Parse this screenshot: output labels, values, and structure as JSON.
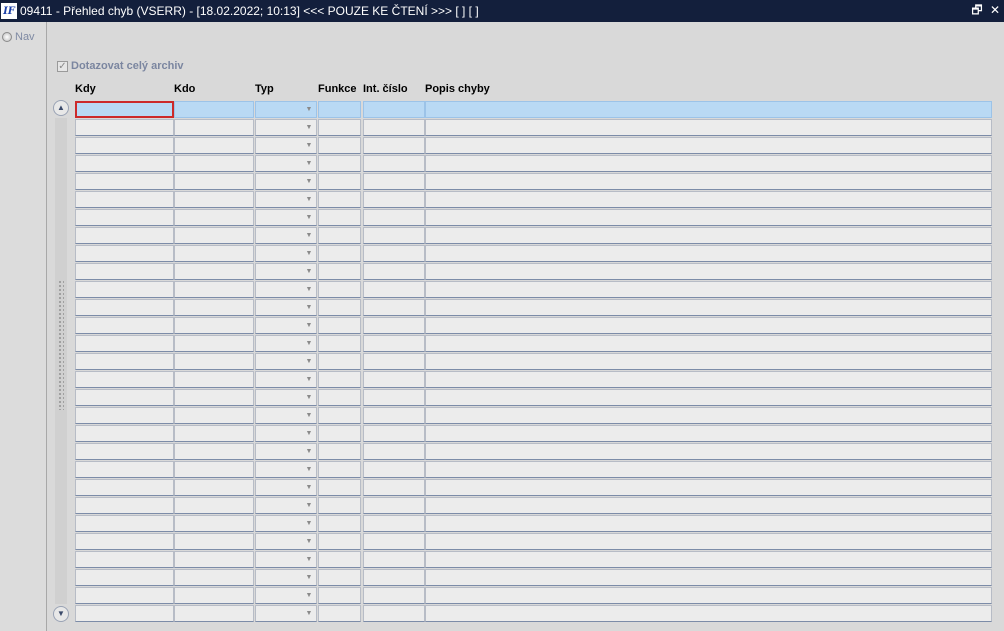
{
  "window": {
    "title": "09411 - Přehled chyb (VSERR) - [18.02.2022; 10:13] <<< POUZE KE ČTENÍ >>>  [ ]  [ ]",
    "icon_label": "IF",
    "restore_glyph": "🗗",
    "close_glyph": "✕"
  },
  "left_panel": {
    "nav_label": "Nav"
  },
  "filter": {
    "archive_label": "Dotazovat celý archiv",
    "archive_checked": true,
    "check_glyph": "✓"
  },
  "table": {
    "headers": [
      "Kdy",
      "Kdo",
      "Typ",
      "Funkce",
      "Int. číslo",
      "Popis chyby"
    ],
    "row_count": 29,
    "active_row": 0
  },
  "scrollbar": {
    "up_glyph": "▲",
    "down_glyph": "▼"
  },
  "dropdown_glyph": "▼"
}
